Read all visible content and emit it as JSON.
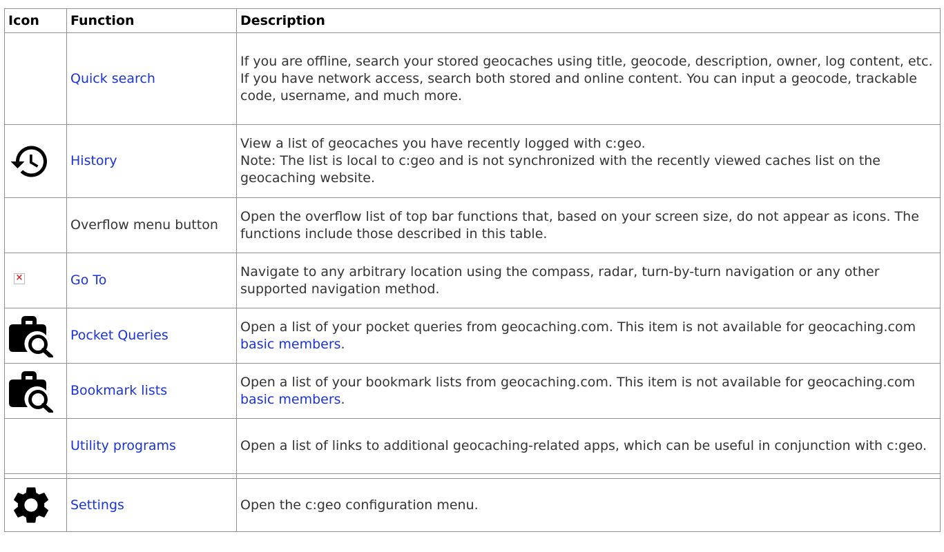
{
  "table": {
    "headers": {
      "icon": "Icon",
      "function": "Function",
      "description": "Description"
    },
    "rows": [
      {
        "icon": "none",
        "function": "Quick search",
        "function_is_link": true,
        "description": [
          "If you are offline, search your stored geocaches using title, geocode, description, owner, log content, etc.",
          "If you have network access, search both stored and online content. You can input a geocode, trackable code, username, and much more."
        ]
      },
      {
        "icon": "history-icon",
        "function": "History",
        "function_is_link": true,
        "description": [
          "View a list of geocaches you have recently logged with c:geo.",
          "Note: The list is local to c:geo and is not synchronized with the recently viewed caches list on the geocaching website."
        ]
      },
      {
        "icon": "none",
        "function": "Overflow menu button",
        "function_is_link": false,
        "description": [
          "Open the overflow list of top bar functions that, based on your screen size, do not appear as icons. The functions include those described in this table."
        ]
      },
      {
        "icon": "broken-image-icon",
        "function": "Go To",
        "function_is_link": true,
        "description": [
          "Navigate to any arbitrary location using the compass, radar, turn-by-turn navigation or any other supported navigation method."
        ]
      },
      {
        "icon": "briefcase-search-icon",
        "function": "Pocket Queries",
        "function_is_link": true,
        "description_before_link": "Open a list of your pocket queries from geocaching.com. This item is not available for geocaching.com ",
        "description_link": "basic members",
        "description_after_link": "."
      },
      {
        "icon": "briefcase-search-icon",
        "function": "Bookmark lists",
        "function_is_link": true,
        "description_before_link": "Open a list of your bookmark lists from geocaching.com. This item is not available for geocaching.com ",
        "description_link": "basic members",
        "description_after_link": "."
      },
      {
        "icon": "none",
        "function": "Utility programs",
        "function_is_link": true,
        "description": [
          "Open a list of links to additional geocaching-related apps, which can be useful in conjunction with c:geo."
        ]
      },
      {
        "icon": "gear-icon",
        "function": "Settings",
        "function_is_link": true,
        "description": [
          "Open the c:geo configuration menu."
        ]
      }
    ]
  },
  "colors": {
    "link": "#1a33d6",
    "text": "#333333",
    "header_text": "#000000",
    "border": "#8f8f8f",
    "icon": "#000000"
  }
}
